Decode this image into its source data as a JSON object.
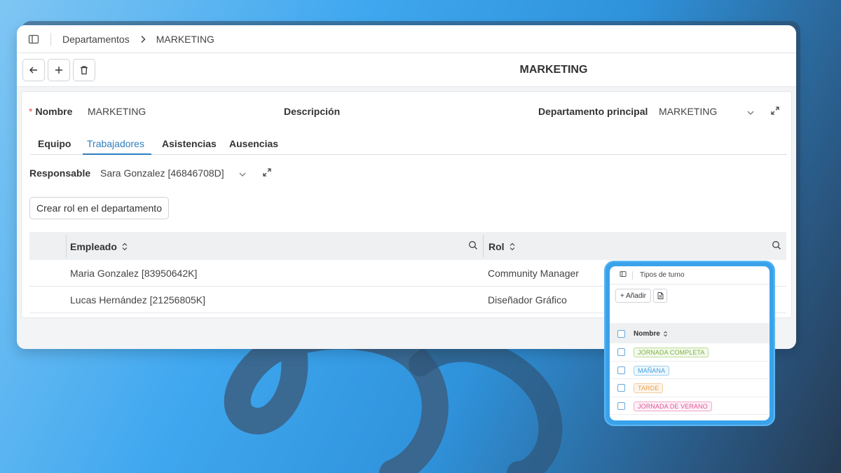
{
  "breadcrumb": {
    "parent": "Departamentos",
    "current": "MARKETING"
  },
  "page": {
    "title": "MARKETING"
  },
  "form": {
    "nombre_label": "Nombre",
    "nombre_value": "MARKETING",
    "descripcion_label": "Descripción",
    "dep_principal_label": "Departamento principal",
    "dep_principal_value": "MARKETING",
    "tabs": [
      "Equipo",
      "Trabajadores",
      "Asistencias",
      "Ausencias"
    ],
    "active_tab": "Trabajadores",
    "responsable_label": "Responsable",
    "responsable_value": "Sara Gonzalez [46846708D]",
    "create_role_button": "Crear rol en el departamento"
  },
  "table": {
    "columns": [
      "Empleado",
      "Rol"
    ],
    "rows": [
      {
        "empleado": "Maria Gonzalez [83950642K]",
        "rol": "Community Manager"
      },
      {
        "empleado": "Lucas Hernández [21256805K]",
        "rol": "Diseñador Gráfico"
      }
    ]
  },
  "mini_window": {
    "title": "Tipos de turno",
    "add_button": "+ Añadir",
    "column": "Nombre",
    "rows": [
      {
        "label": "JORNADA COMPLETA",
        "color": "#7cb342"
      },
      {
        "label": "MAÑANA",
        "color": "#3fa2e0"
      },
      {
        "label": "TARDE",
        "color": "#e8a04a"
      },
      {
        "label": "JORNADA DE VERANO",
        "color": "#e0559b"
      }
    ]
  },
  "colors": {
    "accent": "#2f7fbf",
    "required": "#d9534f"
  }
}
